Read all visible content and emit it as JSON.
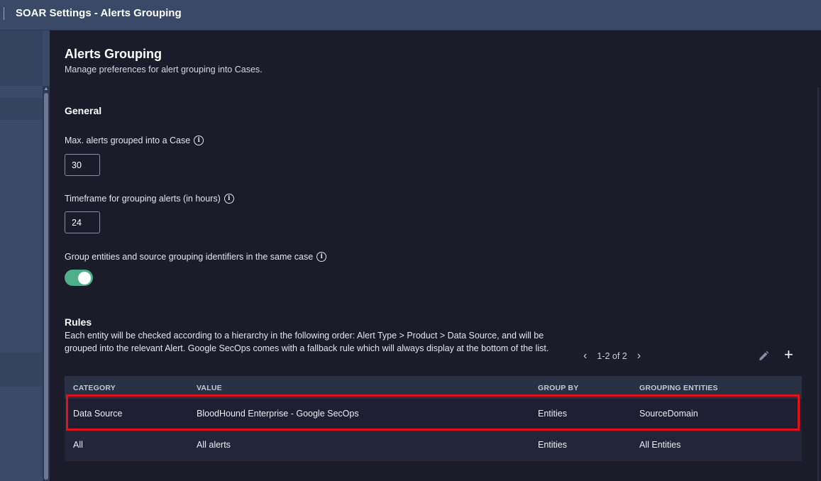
{
  "window": {
    "title": "SOAR Settings - Alerts Grouping"
  },
  "page": {
    "title": "Alerts Grouping",
    "subtitle": "Manage preferences for alert grouping into Cases."
  },
  "general": {
    "heading": "General",
    "max_alerts": {
      "label": "Max. alerts grouped into a Case",
      "value": "30"
    },
    "timeframe": {
      "label": "Timeframe for grouping alerts (in hours)",
      "value": "24"
    },
    "group_entities": {
      "label": "Group entities and source grouping identifiers in the same case",
      "enabled": true
    }
  },
  "rules": {
    "heading": "Rules",
    "description": "Each entity will be checked according to a hierarchy in the following order: Alert Type > Product > Data Source, and will be grouped into the relevant Alert. Google SecOps comes with a fallback rule which will always display at the bottom of the list.",
    "pagination": "1-2 of 2",
    "columns": [
      "CATEGORY",
      "VALUE",
      "GROUP BY",
      "GROUPING ENTITIES"
    ],
    "rows": [
      {
        "category": "Data Source",
        "value": "BloodHound Enterprise - Google SecOps",
        "group_by": "Entities",
        "grouping_entities": "SourceDomain",
        "highlighted": true
      },
      {
        "category": "All",
        "value": "All alerts",
        "group_by": "Entities",
        "grouping_entities": "All Entities",
        "highlighted": false
      }
    ]
  },
  "colors": {
    "accent_toggle": "#4caf8a",
    "highlight_border": "#e0121a",
    "topbar": "#3a4968"
  },
  "icons": [
    "info-icon",
    "chevron-left-icon",
    "chevron-right-icon",
    "pencil-icon",
    "plus-icon"
  ]
}
